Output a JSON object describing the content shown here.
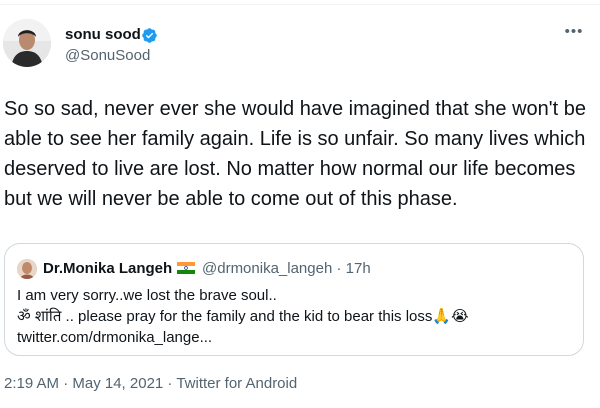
{
  "author": {
    "name": "sonu sood",
    "handle": "@SonuSood"
  },
  "icons": {
    "verified": "verified-badge-icon",
    "more": "more-options-icon",
    "flag": "india-flag-icon",
    "emoji_folded_hands": "🙏",
    "emoji_crying": "😭"
  },
  "more_glyph": "•••",
  "tweet": {
    "text": "So so sad, never ever she would have imagined that she won't be able to see her family again. Life is so unfair. So many lives which deserved to live are lost. No matter how normal our life becomes but we will never be able to come out of this phase."
  },
  "quoted_tweet": {
    "author_name": "Dr.Monika Langeh",
    "handle_time": "@drmonika_langeh · 17h",
    "line1": "I am very sorry..we lost the brave soul..",
    "line2": "ॐ शांति .. please pray for the family and the kid to bear this loss",
    "line3": "twitter.com/drmonika_lange..."
  },
  "meta": {
    "text": "2:19 AM · May 14, 2021 · Twitter for Android"
  },
  "colors": {
    "text": "#0f1419",
    "secondary": "#536471",
    "verified": "#1d9bf0",
    "border": "#cfd9de"
  }
}
